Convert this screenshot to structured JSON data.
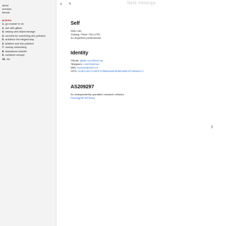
{
  "site_title": "Nichi Yorozuya",
  "toolbar": {
    "menu_icon": "≡",
    "edit_icon": "✎"
  },
  "sidebar": {
    "links": [
      "about",
      "services",
      "friends"
    ],
    "articles_heading": "articles",
    "articles": [
      {
        "num": "1.",
        "title": "go module in nix"
      },
      {
        "num": "2.",
        "title": "ssh with github"
      },
      {
        "num": "3.",
        "title": "backup and object storage"
      },
      {
        "num": "4.",
        "title": "coredns for countering dns pollution"
      },
      {
        "num": "5.",
        "title": "archlinux the elegant way"
      },
      {
        "num": "6.",
        "title": "iptables and dns pollution"
      },
      {
        "num": "7.",
        "title": "overlay networking"
      },
      {
        "num": "8.",
        "title": "standalone kubelet"
      },
      {
        "num": "9.",
        "title": "container escape"
      },
      {
        "num": "10.",
        "title": "etc"
      }
    ]
  },
  "self": {
    "title": "Self",
    "lines": [
      "Nick Cao",
      "Golang / Rust / Nix,LOSI",
      "An imperfect perfectionist"
    ]
  },
  "identity": {
    "title": "Identity",
    "rows": [
      {
        "label": "GitLab:",
        "value": "gitlab.com/NickCao"
      },
      {
        "label": "Telegram:",
        "value": "t.me/NickCao"
      },
      {
        "label": "Mail:",
        "value": "nickcao@nichi.co"
      },
      {
        "label": "GPG:",
        "value": "A15D13A7C0DEF1CBB0AA4EB0BEA58CEF4B9A2C1"
      }
    ]
  },
  "asn": {
    "title": "AS209297",
    "lines": [
      "An independently operated research network"
    ],
    "link": "PeeringDB RIPEstat"
  },
  "next_icon": "›"
}
